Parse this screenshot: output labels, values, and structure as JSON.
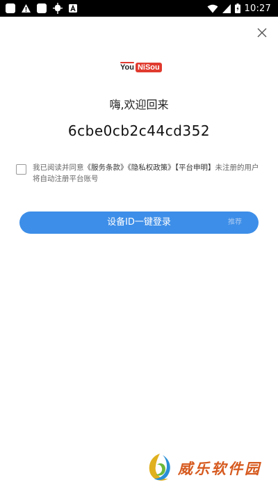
{
  "status_bar": {
    "time": "10:27",
    "icons": [
      "app-icon",
      "warning-icon",
      "bug-icon",
      "a-icon",
      "wifi-icon",
      "signal-icon",
      "battery-icon"
    ]
  },
  "logo": {
    "part1": "You",
    "part2": "NiSou",
    "accent_color": "#e03a2e"
  },
  "welcome_text": "嗨,欢迎回来",
  "device_id": "6cbe0cb2c44cd352",
  "agreement": {
    "checked": false,
    "prefix": "我已阅读并同意",
    "terms": "《服务条款》",
    "privacy": "《隐私权政策》",
    "statement": "【平台申明】",
    "suffix": "未注册的用户将自动注册平台账号"
  },
  "login_button": {
    "label": "设备ID一键登录",
    "badge": "推荐",
    "color": "#3d8ee8"
  },
  "watermark": {
    "text": "威乐软件园"
  }
}
